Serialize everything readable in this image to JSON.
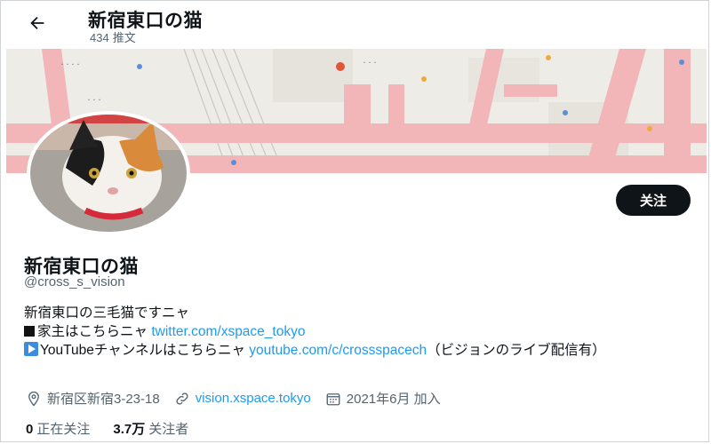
{
  "header": {
    "back_icon": "arrow-left-icon",
    "title": "新宿東口の猫",
    "post_count": "434",
    "post_count_label": "推文"
  },
  "banner": {
    "alt": "map"
  },
  "avatar": {
    "alt": "calico cat"
  },
  "actions": {
    "follow_label": "关注"
  },
  "profile": {
    "name": "新宿東口の猫",
    "handle": "@cross_s_vision"
  },
  "bio": {
    "line1": "新宿東口の三毛猫ですニャ",
    "line2_text": "家主はこちらニャ ",
    "line2_link": "twitter.com/xspace_tokyo",
    "line3_text": "YouTubeチャンネルはこちらニャ ",
    "line3_link": "youtube.com/c/crossspacech",
    "line3_suffix": "（ビジョンのライブ配信有）"
  },
  "meta": {
    "location": "新宿区新宿3-23-18",
    "website": "vision.xspace.tokyo",
    "joined": "2021年6月 加入"
  },
  "stats": {
    "following_count": "0",
    "following_label": "正在关注",
    "followers_count": "3.7万",
    "followers_label": "关注者"
  },
  "colors": {
    "link": "#1d9bf0",
    "button": "#0f1419",
    "muted": "#536471"
  }
}
